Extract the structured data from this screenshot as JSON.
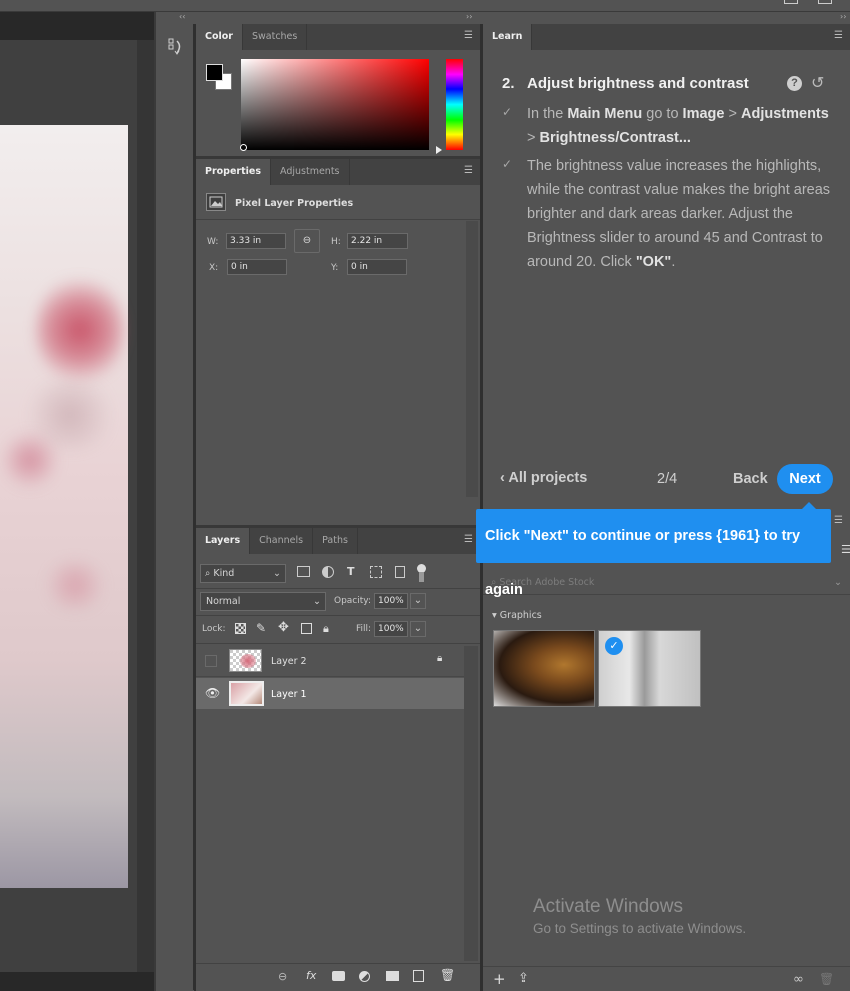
{
  "collapse_icons": {
    "left": "‹‹",
    "middle": "››",
    "right": "››"
  },
  "color_panel": {
    "tabs": [
      "Color",
      "Swatches"
    ],
    "foreground_color": "#000000",
    "background_color": "#ffffff"
  },
  "properties_panel": {
    "tabs": [
      "Properties",
      "Adjustments"
    ],
    "header": "Pixel Layer Properties",
    "w_label": "W:",
    "w_value": "3.33 in",
    "h_label": "H:",
    "h_value": "2.22 in",
    "x_label": "X:",
    "x_value": "0 in",
    "y_label": "Y:",
    "y_value": "0 in"
  },
  "layers_panel": {
    "tabs": [
      "Layers",
      "Channels",
      "Paths"
    ],
    "filter_kind": "Kind",
    "blend_mode": "Normal",
    "opacity_label": "Opacity:",
    "opacity_value": "100%",
    "lock_label": "Lock:",
    "fill_label": "Fill:",
    "fill_value": "100%",
    "layers": [
      {
        "name": "Layer 2",
        "visible": false,
        "locked": true
      },
      {
        "name": "Layer 1",
        "visible": true,
        "locked": false,
        "selected": true
      }
    ]
  },
  "learn_panel": {
    "tab": "Learn",
    "step_number": "2.",
    "step_title": "Adjust brightness and contrast",
    "instr1": {
      "a": "In the ",
      "b": "Main Menu",
      "c": " go to ",
      "d": "Image",
      "e": " > ",
      "f": "Adjustments",
      "g": " > ",
      "h": "Brightness/Contrast..."
    },
    "instr2": {
      "a": "The brightness value increases the highlights, while the contrast value makes the bright areas brighter and dark areas darker. Adjust the Brightness slider to around 45 and Contrast to around 20. Click ",
      "b": "\"OK\"",
      "c": "."
    },
    "all_projects": "All projects",
    "progress": "2/4",
    "back": "Back",
    "next": "Next"
  },
  "tooltip": {
    "text": "Click \"Next\" to continue or press {1961} to try again"
  },
  "libraries_panel": {
    "search_placeholder": "Search Adobe Stock",
    "section": "Graphics"
  },
  "watermark": {
    "title": "Activate Windows",
    "subtitle": "Go to Settings to activate Windows."
  }
}
